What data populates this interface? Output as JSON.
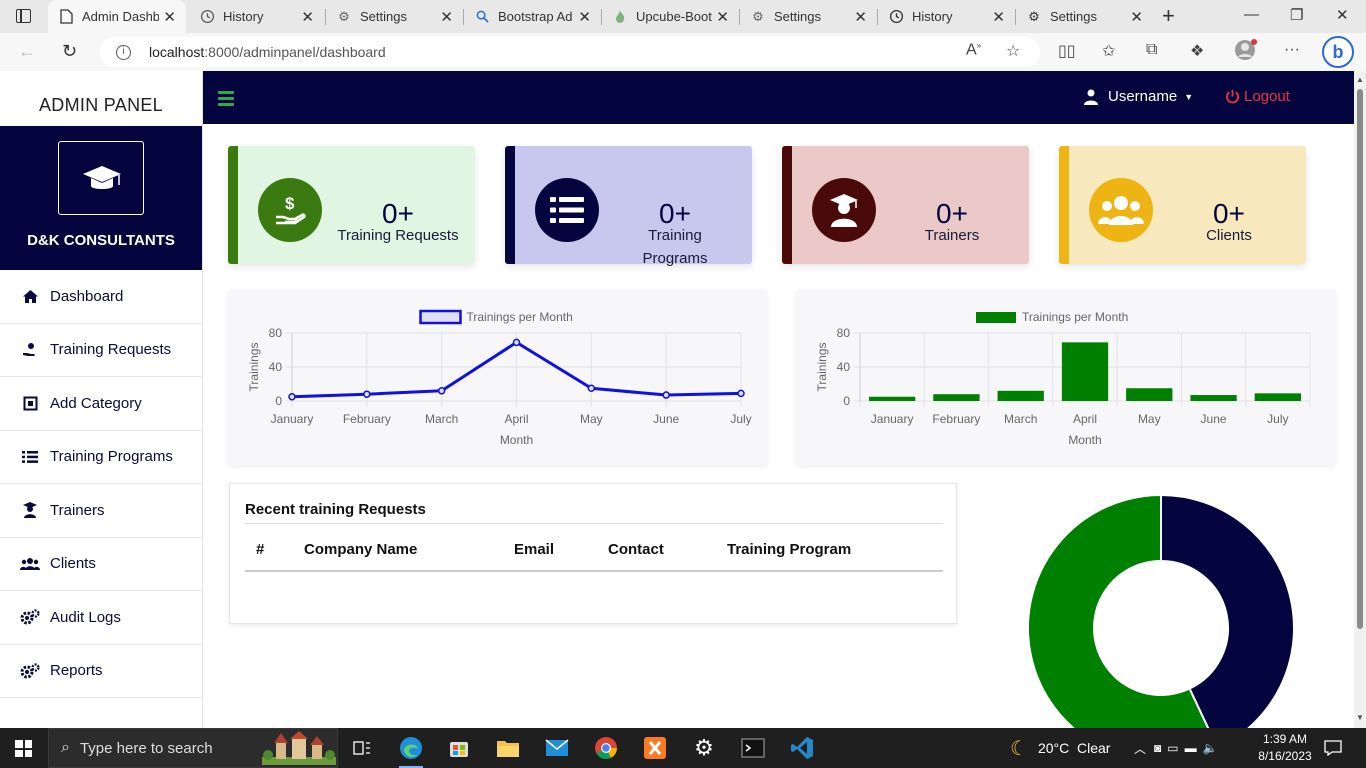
{
  "browser": {
    "tabs": [
      {
        "label": "Admin Dashb",
        "icon": "document-icon",
        "active": true
      },
      {
        "label": "History",
        "icon": "history-icon"
      },
      {
        "label": "Settings",
        "icon": "gear-icon"
      },
      {
        "label": "Bootstrap Ad",
        "icon": "search-icon"
      },
      {
        "label": "Upcube-Boot",
        "icon": "flame-icon"
      },
      {
        "label": "Settings",
        "icon": "gear-icon"
      },
      {
        "label": "History",
        "icon": "history-icon"
      },
      {
        "label": "Settings",
        "icon": "gear-icon"
      }
    ],
    "url_host": "localhost",
    "url_path": ":8000/adminpanel/dashboard"
  },
  "sidebar": {
    "title": "ADMIN PANEL",
    "brand": "D&K CONSULTANTS",
    "items": [
      {
        "label": "Dashboard",
        "icon": "home-icon"
      },
      {
        "label": "Training Requests",
        "icon": "hand-holding-icon"
      },
      {
        "label": "Add Category",
        "icon": "category-box-icon"
      },
      {
        "label": "Training Programs",
        "icon": "list-icon"
      },
      {
        "label": "Trainers",
        "icon": "teacher-icon"
      },
      {
        "label": "Clients",
        "icon": "users-icon"
      },
      {
        "label": "Audit Logs",
        "icon": "gears-icon"
      },
      {
        "label": "Reports",
        "icon": "gears-icon"
      }
    ]
  },
  "navbar": {
    "username": "Username",
    "logout": "Logout"
  },
  "stats": [
    {
      "value": "0+",
      "label": "Training Requests",
      "icon": "dollar-hand-icon",
      "accent": "#3a7a10",
      "bg": "#e0f5e2"
    },
    {
      "value": "0+",
      "label": "Training Programs",
      "icon": "list-icon",
      "accent": "#04053f",
      "bg": "#c8c8ee"
    },
    {
      "value": "0+",
      "label": "Trainers",
      "icon": "teacher-icon",
      "accent": "#4a0a0a",
      "bg": "#ebc9c8"
    },
    {
      "value": "0+",
      "label": "Clients",
      "icon": "users-icon",
      "accent": "#eeb414",
      "bg": "#f7e9bd"
    }
  ],
  "chart_data": [
    {
      "type": "line",
      "legend": "Trainings per Month",
      "xlabel": "Month",
      "ylabel": "Trainings",
      "categories": [
        "January",
        "February",
        "March",
        "April",
        "May",
        "June",
        "July"
      ],
      "values": [
        5,
        8,
        12,
        69,
        15,
        7,
        9
      ],
      "yticks": [
        0,
        40,
        80
      ],
      "ylim": [
        0,
        80
      ],
      "color": "#1010e0",
      "grid": true
    },
    {
      "type": "bar",
      "legend": "Trainings per Month",
      "xlabel": "Month",
      "ylabel": "Trainings",
      "categories": [
        "January",
        "February",
        "March",
        "April",
        "May",
        "June",
        "July"
      ],
      "values": [
        5,
        8,
        12,
        69,
        15,
        7,
        9
      ],
      "yticks": [
        0,
        40,
        80
      ],
      "ylim": [
        0,
        80
      ],
      "color": "#008000",
      "grid": true
    },
    {
      "type": "pie",
      "values": [
        43,
        57
      ],
      "colors": [
        "#04053f",
        "#008000"
      ]
    }
  ],
  "recent_requests": {
    "title": "Recent training Requests",
    "columns": [
      "#",
      "Company Name",
      "Email",
      "Contact",
      "Training Program"
    ]
  },
  "taskbar": {
    "search_placeholder": "Type here to search",
    "weather": "20°C  Clear",
    "time": "1:39 AM",
    "date": "8/16/2023"
  }
}
